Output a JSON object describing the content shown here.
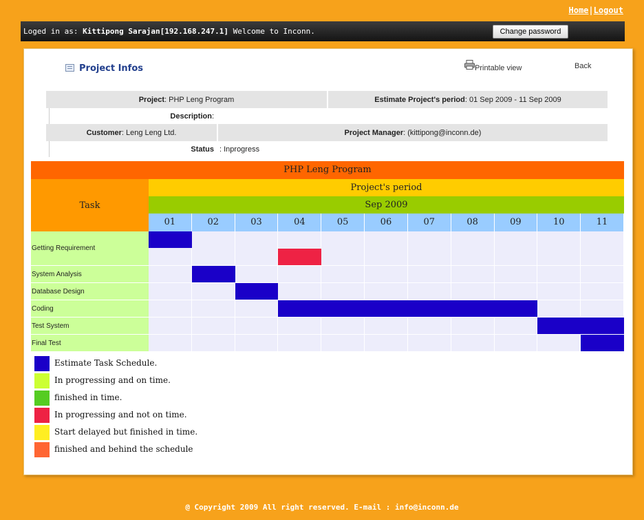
{
  "top_links": {
    "home": "Home",
    "separator": "|",
    "logout": "Logout"
  },
  "login_bar": {
    "prefix": "Loged in as: ",
    "user": "Kittipong Sarajan[192.168.247.1]",
    "suffix": " Welcome to Inconn.",
    "change_password": "Change password"
  },
  "header": {
    "title": "Project Infos",
    "printable": "Printable view",
    "back": "Back"
  },
  "info": {
    "project_label": "Project",
    "project_value": " : PHP Leng Program",
    "period_label": "Estimate Project's period",
    "period_value": " : 01 Sep 2009 - 11 Sep 2009",
    "description_label": "Description",
    "description_sep": " :",
    "customer_label": "Customer",
    "customer_value": " : Leng Leng Ltd.",
    "manager_label": "Project Manager",
    "manager_value": ": (kittipong@inconn.de)",
    "status_label": "Status",
    "status_value": " :  Inprogress"
  },
  "gantt": {
    "title": "PHP Leng Program",
    "task_header": "Task",
    "period_header": "Project's period",
    "month": "Sep 2009",
    "days": [
      "01",
      "02",
      "03",
      "04",
      "05",
      "06",
      "07",
      "08",
      "09",
      "10",
      "11"
    ],
    "tasks": [
      {
        "name": "Getting Requirement",
        "bars": [
          {
            "start": 1,
            "end": 1,
            "row": 0,
            "status": "estimate"
          },
          {
            "start": 4,
            "end": 4,
            "row": 1,
            "status": "late"
          }
        ]
      },
      {
        "name": "System Analysis",
        "bars": [
          {
            "start": 2,
            "end": 2,
            "row": 0,
            "status": "estimate"
          }
        ]
      },
      {
        "name": "Database Design",
        "bars": [
          {
            "start": 3,
            "end": 3,
            "row": 0,
            "status": "estimate"
          }
        ]
      },
      {
        "name": "Coding",
        "bars": [
          {
            "start": 4,
            "end": 9,
            "row": 0,
            "status": "estimate"
          }
        ]
      },
      {
        "name": "Test System",
        "bars": [
          {
            "start": 10,
            "end": 11,
            "row": 0,
            "status": "estimate"
          }
        ]
      },
      {
        "name": "Final Test",
        "bars": [
          {
            "start": 11,
            "end": 11,
            "row": 0,
            "status": "estimate"
          }
        ]
      }
    ]
  },
  "legend": [
    {
      "label": "Estimate Task Schedule.",
      "color": "#1a00c8"
    },
    {
      "label": "In progressing and on time.",
      "color": "#ccff33"
    },
    {
      "label": "finished in time.",
      "color": "#55cc22"
    },
    {
      "label": "In progressing and not on time.",
      "color": "#ee2244"
    },
    {
      "label": "Start delayed but finished in time.",
      "color": "#ffee22"
    },
    {
      "label": "finished and behind the schedule",
      "color": "#ff6633"
    }
  ],
  "colors": {
    "estimate": "#1a00c8",
    "late": "#ee2244"
  },
  "footer": "@ Copyright 2009 All right reserved. E-mail : info@inconn.de"
}
